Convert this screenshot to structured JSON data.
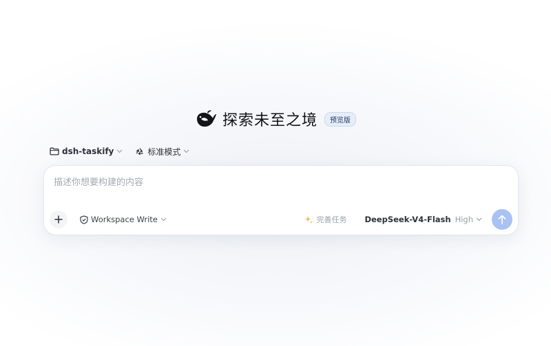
{
  "hero": {
    "title": "探索未至之境",
    "badge": "预览版"
  },
  "context": {
    "project": "dsh-taskify",
    "mode": "标准模式"
  },
  "composer": {
    "placeholder": "描述你想要构建的内容",
    "value": "",
    "permission": "Workspace Write",
    "task_action": "完善任务",
    "model": "DeepSeek-V4-Flash",
    "model_level": "High"
  },
  "icons": {
    "logo": "deepseek-whale-icon",
    "folder": "folder-icon",
    "mode": "recycle-icon",
    "add": "plus-icon",
    "permission": "shield-icon",
    "task": "sparkle-icon",
    "send": "arrow-up-icon",
    "chevron": "chevron-down-icon"
  },
  "colors": {
    "accent_send": "#a9c1f3",
    "badge_bg": "#e7eef9",
    "sparkle": "#f0b84a"
  }
}
